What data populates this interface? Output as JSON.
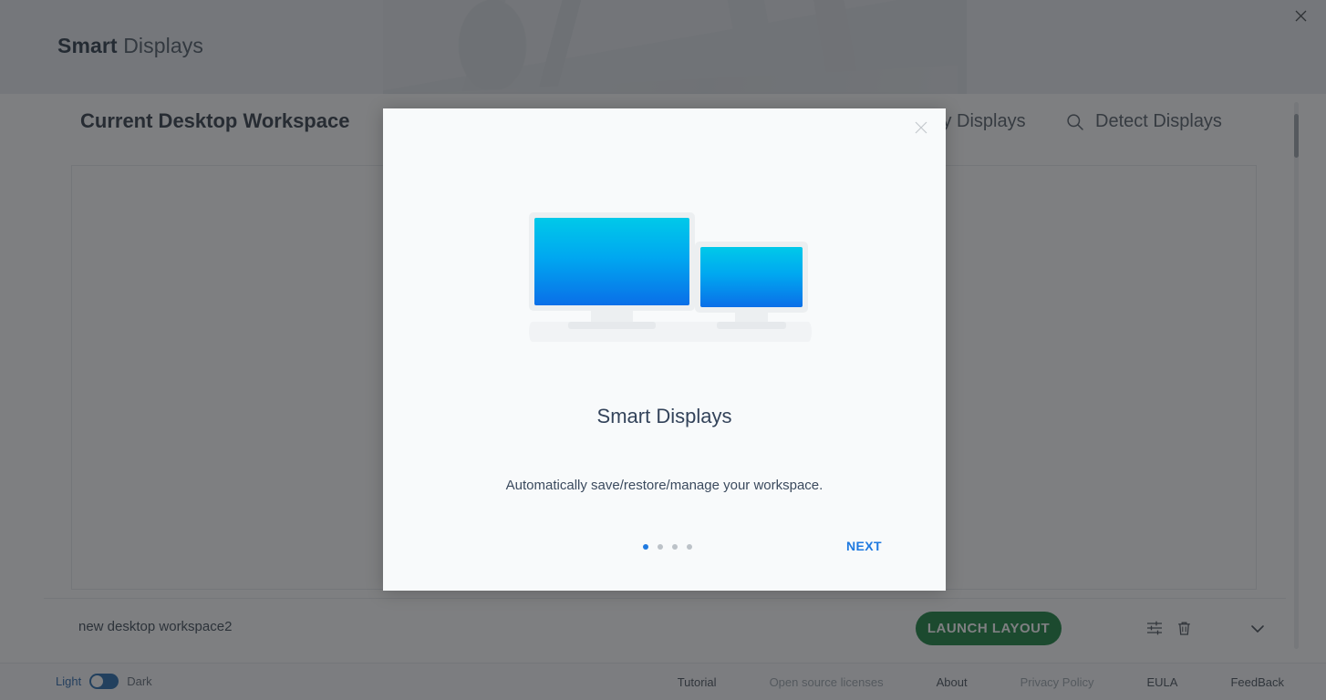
{
  "window": {
    "title_strong": "Smart",
    "title_light": "Displays",
    "close_icon": "close-icon"
  },
  "content_header": {
    "workspace_heading": "Current Desktop Workspace",
    "actions": [
      {
        "label": "Identify Displays",
        "icon": "identify-displays-icon"
      },
      {
        "label": "Detect Displays",
        "icon": "search-icon"
      }
    ]
  },
  "workspace_row": {
    "name": "new desktop workspace2",
    "launch_label": "LAUNCH LAYOUT",
    "settings_icon": "sliders-icon",
    "delete_icon": "trash-icon",
    "expand_icon": "chevron-down-icon"
  },
  "footer": {
    "theme": {
      "light_label": "Light",
      "dark_label": "Dark",
      "active": "Light"
    },
    "links": [
      {
        "label": "Tutorial",
        "muted": false
      },
      {
        "label": "Open source licenses",
        "muted": true
      },
      {
        "label": "About",
        "muted": false
      },
      {
        "label": "Privacy Policy",
        "muted": true
      },
      {
        "label": "EULA",
        "muted": false
      },
      {
        "label": "FeedBack",
        "muted": false
      }
    ]
  },
  "modal": {
    "close_icon": "close-icon",
    "title": "Smart Displays",
    "subtitle": "Automatically save/restore/manage your workspace.",
    "next_label": "NEXT",
    "pager": {
      "total": 4,
      "active_index": 0
    },
    "illustration": "dual-monitors-icon"
  },
  "colors": {
    "accent_blue": "#1f7ae0",
    "launch_green": "#0c7a33",
    "toggle_blue": "#1b63a8",
    "screen_top": "#00c9e9",
    "screen_bottom": "#0a6fe8"
  }
}
